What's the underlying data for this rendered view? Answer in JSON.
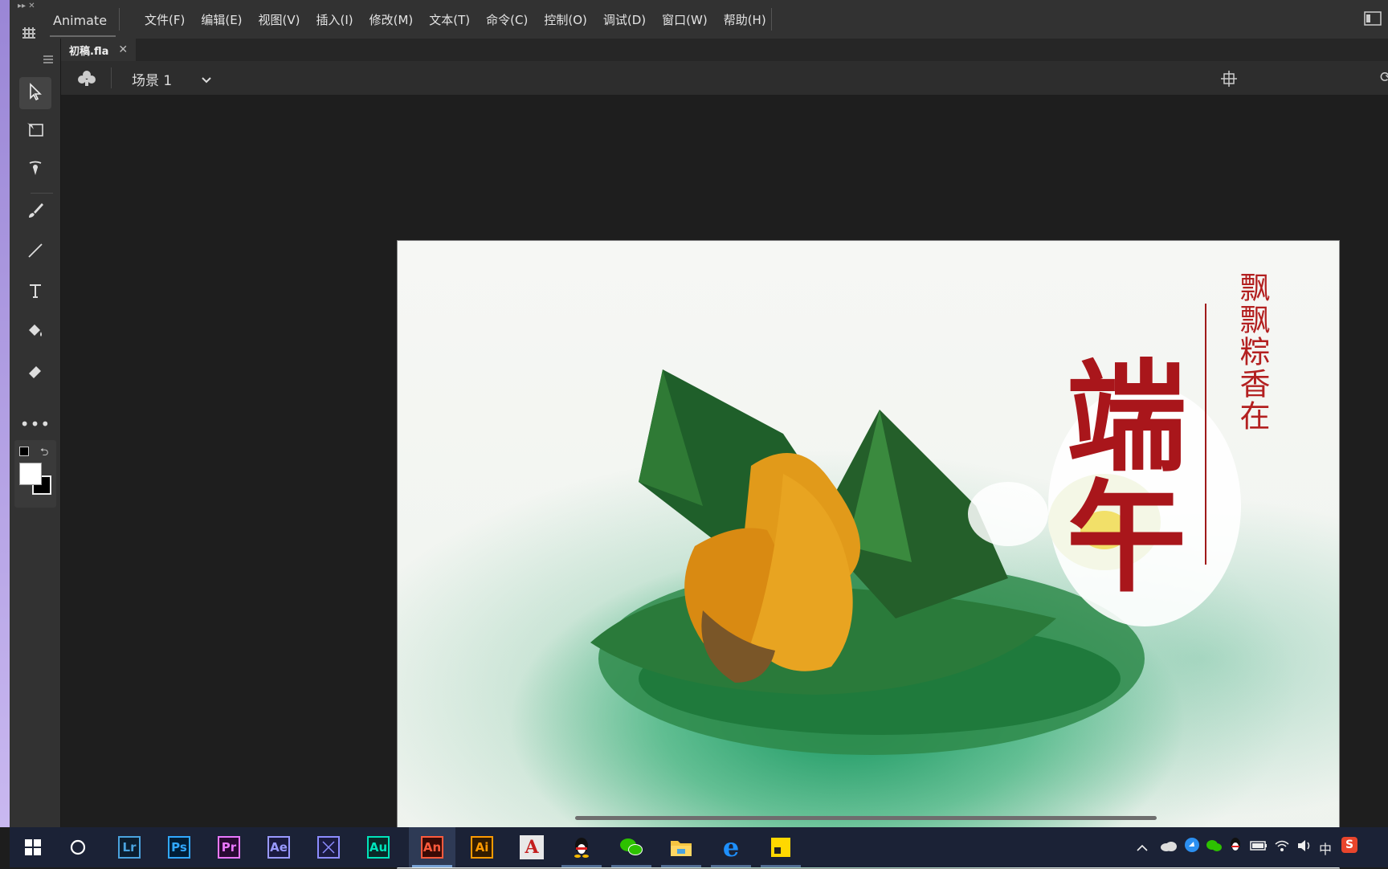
{
  "app": {
    "name": "Animate",
    "menu": [
      "文件(F)",
      "编辑(E)",
      "视图(V)",
      "插入(I)",
      "修改(M)",
      "文本(T)",
      "命令(C)",
      "控制(O)",
      "调试(D)",
      "窗口(W)",
      "帮助(H)"
    ]
  },
  "document": {
    "tab_name": "初稿.fla",
    "close_glyph": "✕"
  },
  "scene": {
    "name": "场景 1"
  },
  "tools": [
    {
      "name": "selection-tool",
      "icon": "arrow-icon",
      "active": true
    },
    {
      "name": "free-transform-tool",
      "icon": "transform-icon"
    },
    {
      "name": "asset-warp-tool",
      "icon": "warp-icon"
    },
    {
      "name": "brush-tool",
      "icon": "brush-icon"
    },
    {
      "name": "line-tool",
      "icon": "line-icon"
    },
    {
      "name": "text-tool",
      "icon": "text-icon"
    },
    {
      "name": "paint-bucket-tool",
      "icon": "bucket-icon"
    },
    {
      "name": "eraser-tool",
      "icon": "eraser-icon"
    },
    {
      "name": "more-tools",
      "icon": "ellipsis-icon"
    }
  ],
  "colors": {
    "stroke": "#000000",
    "fill": "#ffffff"
  },
  "stage_art": {
    "vertical_poem": "飘飘粽香在",
    "title_calligraphy": "端午"
  },
  "taskbar": {
    "apps": [
      {
        "id": "lightroom",
        "label": "Lr",
        "color": "#4aa3df"
      },
      {
        "id": "photoshop",
        "label": "Ps",
        "color": "#31a8ff"
      },
      {
        "id": "premiere",
        "label": "Pr",
        "color": "#ea77ff"
      },
      {
        "id": "after-effects",
        "label": "Ae",
        "color": "#9999ff"
      },
      {
        "id": "media-encoder",
        "label": "",
        "color": "#8c8cff"
      },
      {
        "id": "audition",
        "label": "Au",
        "color": "#00e4bb"
      },
      {
        "id": "animate",
        "label": "An",
        "color": "#ff5a3c"
      },
      {
        "id": "illustrator",
        "label": "Ai",
        "color": "#ff9a00"
      }
    ],
    "tray_ime": "中"
  }
}
